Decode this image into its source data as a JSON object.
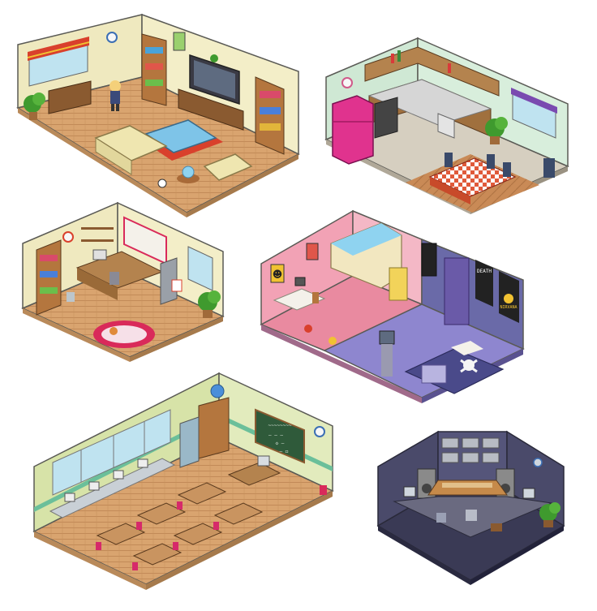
{
  "colors": {
    "bg": "#ffffff",
    "outline": "#5a5a55",
    "wood_floor": "#d9a46f",
    "wood_floor_dark": "#c28a58",
    "wall_cream": "#efe9bf",
    "wall_mint": "#cfe8d4",
    "wall_pink": "#f2a2b5",
    "floor_pink": "#e98aa0",
    "floor_purple": "#8e86cf",
    "wall_green": "#d7e3a8",
    "studio_wall": "#4a4a6a",
    "studio_floor": "#3a3a55",
    "plant": "#3f9a2e",
    "fridge_pink": "#e0338e",
    "rug_red": "#cc2244",
    "tablecloth": "#e05a3a",
    "chalkboard": "#2f5a3a",
    "chair_pink": "#d62a6a",
    "skull_white": "#f5f5f5",
    "poster_black": "#222222",
    "speaker_grey": "#8a8a8a",
    "tv_dark": "#444455"
  },
  "rooms": [
    {
      "name": "living-room",
      "icons": [
        "tv-icon",
        "sofa-icon",
        "plant-icon",
        "bookshelf-icon",
        "person-icon",
        "clock-icon",
        "table-icon"
      ]
    },
    {
      "name": "kitchen",
      "icons": [
        "fridge-icon",
        "stove-icon",
        "table-icon",
        "chair-icon",
        "plant-icon",
        "clock-icon",
        "bottle-icon"
      ]
    },
    {
      "name": "office",
      "icons": [
        "desk-icon",
        "bookshelf-icon",
        "corkboard-icon",
        "rug-icon",
        "plant-icon",
        "clock-icon",
        "filing-cabinet-icon"
      ]
    },
    {
      "name": "teen-bedroom",
      "icons": [
        "bunk-bed-icon",
        "poster-icon",
        "bed-icon",
        "skull-icon",
        "desk-icon",
        "tv-icon"
      ]
    },
    {
      "name": "classroom",
      "icons": [
        "chalkboard-icon",
        "computer-icon",
        "desk-icon",
        "chair-icon",
        "globe-icon",
        "cabinet-icon",
        "clock-icon"
      ]
    },
    {
      "name": "recording-studio",
      "icons": [
        "mixing-console-icon",
        "speaker-icon",
        "monitor-icon",
        "chair-icon",
        "plant-icon",
        "clock-icon"
      ]
    }
  ],
  "classroom": {
    "chalkboard_scribble": "~~~~~~~~",
    "chalkboard_lines": [
      "— — —",
      "◇ —",
      "— ◻"
    ]
  },
  "bedroom": {
    "poster_labels": [
      "DEATH",
      "NIRVANA"
    ],
    "poster_face": "☻"
  }
}
